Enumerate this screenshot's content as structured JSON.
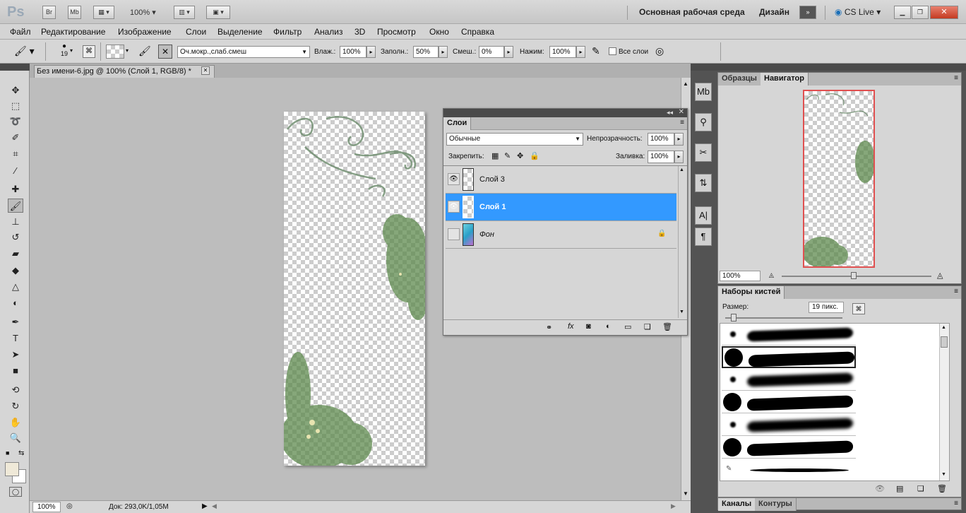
{
  "titlebar": {
    "app_logo": "Ps",
    "bridge": "Br",
    "minibridge": "Mb",
    "zoom": "100%",
    "workspace_main": "Основная рабочая среда",
    "workspace_design": "Дизайн",
    "cslive": "CS Live"
  },
  "menu": [
    "Файл",
    "Редактирование",
    "Изображение",
    "Слои",
    "Выделение",
    "Фильтр",
    "Анализ",
    "3D",
    "Просмотр",
    "Окно",
    "Справка"
  ],
  "options": {
    "brush_size": "19",
    "mode": "Оч.мокр.,слаб.смеш",
    "wet_label": "Влаж.:",
    "wet_value": "100%",
    "load_label": "Заполн.:",
    "load_value": "50%",
    "mix_label": "Смеш.:",
    "mix_value": "0%",
    "flow_label": "Нажим:",
    "flow_value": "100%",
    "all_layers": "Все слои"
  },
  "document": {
    "tab_title": "Без имени-6.jpg @ 100% (Слой 1, RGB/8) *",
    "status_zoom": "100%",
    "status_doc": "Док: 293,0K/1,05M"
  },
  "layers_panel": {
    "tab": "Слои",
    "blend_mode": "Обычные",
    "opacity_label": "Непрозрачность:",
    "opacity_value": "100%",
    "lock_label": "Закрепить:",
    "fill_label": "Заливка:",
    "fill_value": "100%",
    "layers": [
      {
        "name": "Слой 3",
        "visible": true,
        "selected": false
      },
      {
        "name": "Слой 1",
        "visible": true,
        "selected": true
      },
      {
        "name": "Фон",
        "visible": false,
        "selected": false,
        "locked": true
      }
    ]
  },
  "navigator": {
    "tab_swatches": "Образцы",
    "tab_navigator": "Навигатор",
    "zoom": "100%"
  },
  "brush_presets": {
    "title": "Наборы кистей",
    "size_label": "Размер:",
    "size_value": "19 пикс."
  },
  "bottom_tabs": {
    "channels": "Каналы",
    "paths": "Контуры"
  },
  "colors": {
    "selection": "#3399ff",
    "foreground": "#efe9d8"
  }
}
